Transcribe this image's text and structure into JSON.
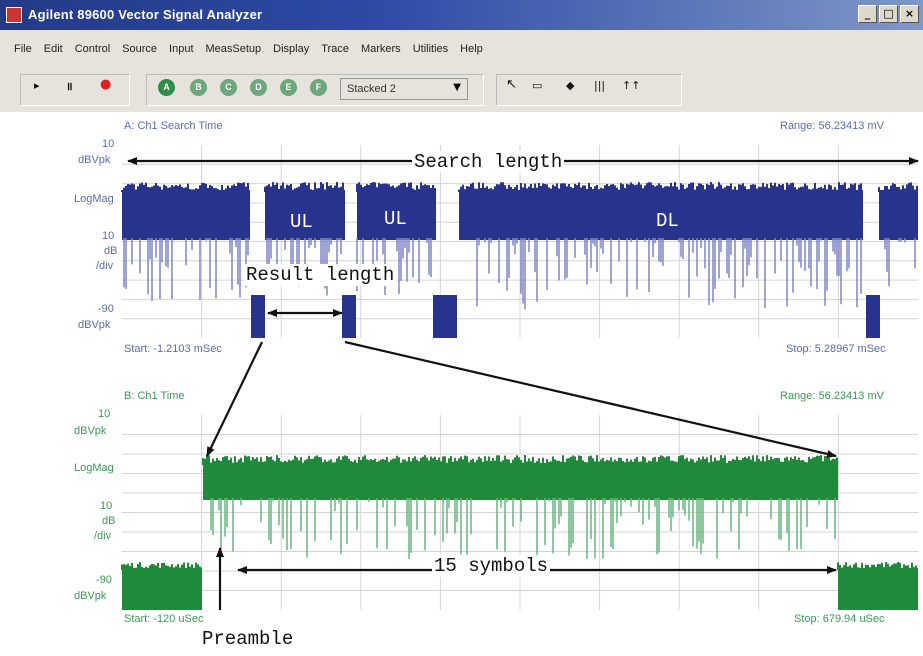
{
  "window": {
    "title": "Agilent 89600 Vector Signal Analyzer",
    "controls": [
      "_",
      "□",
      "×"
    ]
  },
  "menu": [
    "File",
    "Edit",
    "Control",
    "Source",
    "Input",
    "MeasSetup",
    "Display",
    "Trace",
    "Markers",
    "Utilities",
    "Help"
  ],
  "toolbar": {
    "trace_buttons": [
      "A",
      "B",
      "C",
      "D",
      "E",
      "F"
    ],
    "layout_select": "Stacked 2"
  },
  "trace_a": {
    "title": "A: Ch1 Search Time",
    "range": "Range: 56.23413 mV",
    "ref_level": "10",
    "ref_unit": "dBVpk",
    "format": "LogMag",
    "scale": "10",
    "scale_unit1": "dB",
    "scale_unit2": "/div",
    "bottom_level": "-90",
    "bottom_unit": "dBVpk",
    "start": "Start: -1.2103 mSec",
    "stop": "Stop: 5.28967 mSec",
    "color": "#27338c"
  },
  "trace_b": {
    "title": "B: Ch1 Time",
    "range": "Range: 56.23413 mV",
    "ref_level": "10",
    "ref_unit": "dBVpk",
    "format": "LogMag",
    "scale": "10",
    "scale_unit1": "dB",
    "scale_unit2": "/div",
    "bottom_level": "-90",
    "bottom_unit": "dBVpk",
    "start": "Start: -120 uSec",
    "stop": "Stop: 679.94 uSec",
    "color": "#1f8a3a"
  },
  "annotations": {
    "search_length": "Search length",
    "result_length": "Result length",
    "ul1": "UL",
    "ul2": "UL",
    "dl": "DL",
    "symbols": "15 symbols",
    "preamble": "Preamble"
  }
}
